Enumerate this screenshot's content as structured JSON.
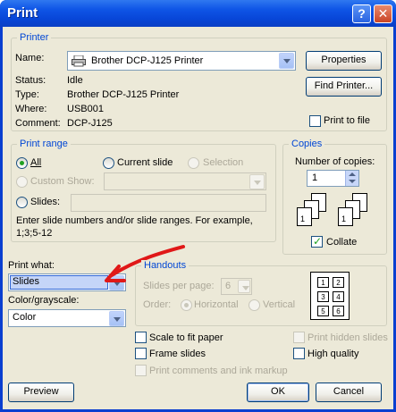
{
  "window": {
    "title": "Print"
  },
  "printer": {
    "legend": "Printer",
    "name_label": "Name:",
    "name_value": "Brother DCP-J125 Printer",
    "properties_button": "Properties",
    "find_printer_button": "Find Printer...",
    "status_label": "Status:",
    "status_value": "Idle",
    "type_label": "Type:",
    "type_value": "Brother DCP-J125 Printer",
    "where_label": "Where:",
    "where_value": "USB001",
    "comment_label": "Comment:",
    "comment_value": "DCP-J125",
    "print_to_file": "Print to file"
  },
  "print_range": {
    "legend": "Print range",
    "all": "All",
    "current_slide": "Current slide",
    "selection": "Selection",
    "custom_show": "Custom Show:",
    "slides": "Slides:",
    "hint": "Enter slide numbers and/or slide ranges. For example, 1;3;5-12"
  },
  "copies": {
    "legend": "Copies",
    "number_label": "Number of copies:",
    "number_value": "1",
    "collate": "Collate",
    "collate_checked": true
  },
  "print_what": {
    "label": "Print what:",
    "value": "Slides"
  },
  "color": {
    "label": "Color/grayscale:",
    "value": "Color"
  },
  "handouts": {
    "legend": "Handouts",
    "slides_per_page_label": "Slides per page:",
    "slides_per_page_value": "6",
    "order_label": "Order:",
    "horizontal": "Horizontal",
    "vertical": "Vertical",
    "preview_numbers": [
      "1",
      "2",
      "3",
      "4",
      "5",
      "6"
    ]
  },
  "options": {
    "scale_to_fit": "Scale to fit paper",
    "frame_slides": "Frame slides",
    "print_comments": "Print comments and ink markup",
    "print_hidden": "Print hidden slides",
    "high_quality": "High quality"
  },
  "buttons": {
    "preview": "Preview",
    "ok": "OK",
    "cancel": "Cancel"
  },
  "annotation": {
    "arrow_color": "#e01818"
  }
}
